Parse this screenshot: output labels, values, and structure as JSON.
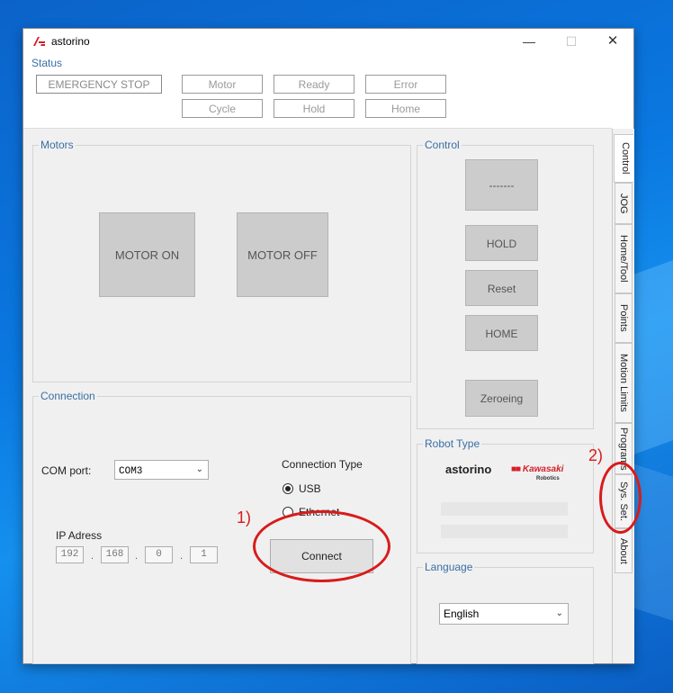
{
  "window": {
    "title": "astorino",
    "controls": {
      "minimize": "—",
      "maximize": "☐",
      "close": "✕"
    }
  },
  "status": {
    "label": "Status",
    "emergency_stop": "EMERGENCY STOP",
    "indicators": [
      "Motor",
      "Ready",
      "Error",
      "Cycle",
      "Hold",
      "Home"
    ]
  },
  "motors": {
    "title": "Motors",
    "motor_on": "MOTOR ON",
    "motor_off": "MOTOR OFF"
  },
  "control": {
    "title": "Control",
    "mode_button": "-------",
    "hold": "HOLD",
    "reset": "Reset",
    "home": "HOME",
    "zeroing": "Zeroeing"
  },
  "connection": {
    "title": "Connection",
    "com_port_label": "COM port:",
    "com_port_value": "COM3",
    "type_label": "Connection Type",
    "usb": "USB",
    "ethernet": "Ethernet",
    "selected_type": "USB",
    "ip_label": "IP Adress",
    "ip": [
      "192",
      "168",
      "0",
      "1"
    ],
    "connect": "Connect"
  },
  "robot_type": {
    "title": "Robot Type",
    "logo_astorino": "astorino",
    "logo_kawasaki": "Kawasaki",
    "logo_robotics": "Robotics"
  },
  "language": {
    "title": "Language",
    "value": "English"
  },
  "tabs": [
    "Control",
    "JOG",
    "Home/Tool",
    "Points",
    "Motion Limits",
    "Programs",
    "Sys. Set.",
    "About"
  ],
  "active_tab": "Control",
  "annotations": {
    "first": "1)",
    "second": "2)"
  },
  "colors": {
    "accent_red": "#d81b1b",
    "group_title": "#3a6ea5",
    "button_grey": "#cccccc"
  }
}
